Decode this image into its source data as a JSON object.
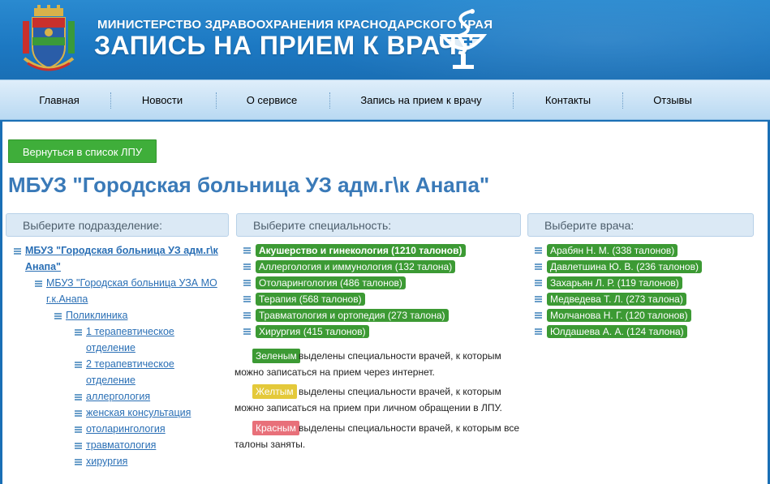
{
  "header": {
    "ministry": "МИНИСТЕРСТВО ЗДРАВООХРАНЕНИЯ КРАСНОДАРСКОГО КРАЯ",
    "title": "ЗАПИСЬ НА ПРИЕМ К ВРАЧУ",
    "coat_icon": "coat-of-arms-icon",
    "logo_icon": "medical-bowl-logo-icon"
  },
  "nav": {
    "items": [
      "Главная",
      "Новости",
      "О сервисе",
      "Запись на прием к врачу",
      "Контакты",
      "Отзывы"
    ]
  },
  "main": {
    "back_button": "Вернуться в список ЛПУ",
    "org_title": "МБУЗ \"Городская больница УЗ адм.г\\к Анапа\"",
    "columns": {
      "division": "Выберите подразделение:",
      "specialty": "Выберите специальность:",
      "doctor": "Выберите врача:"
    },
    "tree": {
      "root_line1": "МБУЗ \"Городская больница УЗ адм.г\\к",
      "root_line2": "Анапа\"",
      "sub_line1": "МБУЗ \"Городская больница УЗА МО",
      "sub_line2": "г.к.Анапа",
      "clinic": "Поликлиника",
      "dept1_line1": "1 терапевтическое",
      "dept1_line2": "отделение",
      "dept2_line1": "2 терапевтическое",
      "dept2_line2": "отделение",
      "allergy": "аллергология",
      "women": "женская консультация",
      "ent": "отоларингология",
      "trauma": "травматология",
      "surgery": "хирургия"
    },
    "specialties": [
      "Акушерство и гинекология (1210 талонов)",
      "Аллергология и иммунология (132 талона)",
      "Отоларингология (486 талонов)",
      "Терапия (568 талонов)",
      "Травматология и ортопедия (273 талона)",
      "Хирургия (415 талонов)"
    ],
    "legend": {
      "green_label": "Зеленым",
      "green_text1": "выделены специальности врачей, к которым",
      "green_text2": "можно записаться на прием через интернет.",
      "yellow_label": "Желтым",
      "yellow_text1": "выделены специальности врачей, к которым",
      "yellow_text2": "можно записаться на прием при личном обращении в ЛПУ.",
      "red_label": "Красным",
      "red_text1": "выделены специальности врачей, к которым все",
      "red_text2": "талоны заняты."
    },
    "doctors": [
      "Арабян Н. М. (338 талонов)",
      "Давлетшина Ю. В. (236 талонов)",
      "Захарьян Л. Р. (119 талонов)",
      "Медведева Т. Л. (273 талона)",
      "Молчанова Н. Г. (120 талонов)",
      "Юлдашева А. А. (124 талона)"
    ]
  },
  "colors": {
    "header_blue": "#1c78c2",
    "badge_green": "#3c9a34",
    "legend_yellow": "#e4c93a",
    "legend_red": "#e8707a",
    "link_blue": "#2a6fb5",
    "title_blue": "#3a7ab8"
  }
}
